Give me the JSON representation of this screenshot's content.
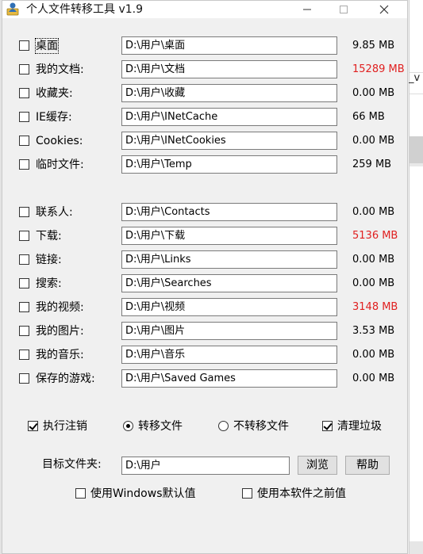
{
  "window": {
    "title": "个人文件转移工具 v1.9",
    "controls": {
      "minimize": "—",
      "maximize": "☐",
      "close": "✕"
    }
  },
  "background_fragment": "_v",
  "folders_group1": [
    {
      "label": "桌面",
      "path": "D:\\用户\\桌面",
      "size": "9.85 MB",
      "highlight": false,
      "checked": false,
      "focused": true
    },
    {
      "label": "我的文档:",
      "path": "D:\\用户\\文档",
      "size": "15289 MB",
      "highlight": true,
      "checked": false
    },
    {
      "label": "收藏夹:",
      "path": "D:\\用户\\收藏",
      "size": "0.00 MB",
      "highlight": false,
      "checked": false
    },
    {
      "label": "IE缓存:",
      "path": "D:\\用户\\INetCache",
      "size": "66 MB",
      "highlight": false,
      "checked": false
    },
    {
      "label": "Cookies:",
      "path": "D:\\用户\\INetCookies",
      "size": "0.00 MB",
      "highlight": false,
      "checked": false
    },
    {
      "label": "临时文件:",
      "path": "D:\\用户\\Temp",
      "size": "259 MB",
      "highlight": false,
      "checked": false
    }
  ],
  "folders_group2": [
    {
      "label": "联系人:",
      "path": "D:\\用户\\Contacts",
      "size": "0.00 MB",
      "highlight": false,
      "checked": false
    },
    {
      "label": "下载:",
      "path": "D:\\用户\\下载",
      "size": "5136 MB",
      "highlight": true,
      "checked": false
    },
    {
      "label": "链接:",
      "path": "D:\\用户\\Links",
      "size": "0.00 MB",
      "highlight": false,
      "checked": false
    },
    {
      "label": "搜索:",
      "path": "D:\\用户\\Searches",
      "size": "0.00 MB",
      "highlight": false,
      "checked": false
    },
    {
      "label": "我的视频:",
      "path": "D:\\用户\\视频",
      "size": "3148 MB",
      "highlight": true,
      "checked": false
    },
    {
      "label": "我的图片:",
      "path": "D:\\用户\\图片",
      "size": "3.53 MB",
      "highlight": false,
      "checked": false
    },
    {
      "label": "我的音乐:",
      "path": "D:\\用户\\音乐",
      "size": "0.00 MB",
      "highlight": false,
      "checked": false
    },
    {
      "label": "保存的游戏:",
      "path": "D:\\用户\\Saved Games",
      "size": "0.00 MB",
      "highlight": false,
      "checked": false
    }
  ],
  "options": {
    "logoff": {
      "label": "执行注销",
      "checked": true
    },
    "move_files": {
      "label": "转移文件",
      "selected": true
    },
    "no_move_files": {
      "label": "不转移文件",
      "selected": false
    },
    "cleanup": {
      "label": "清理垃圾",
      "checked": true
    }
  },
  "target": {
    "label": "目标文件夹:",
    "value": "D:\\用户"
  },
  "buttons": {
    "browse": "浏览",
    "help": "帮助"
  },
  "defaults": {
    "windows_default": {
      "label": "使用Windows默认值",
      "checked": false
    },
    "previous_values": {
      "label": "使用本软件之前值",
      "checked": false
    }
  },
  "colors": {
    "highlight_size": "#e02020",
    "window_bg": "#f0f0f0"
  },
  "icons": {
    "app": "user-folder-icon"
  }
}
